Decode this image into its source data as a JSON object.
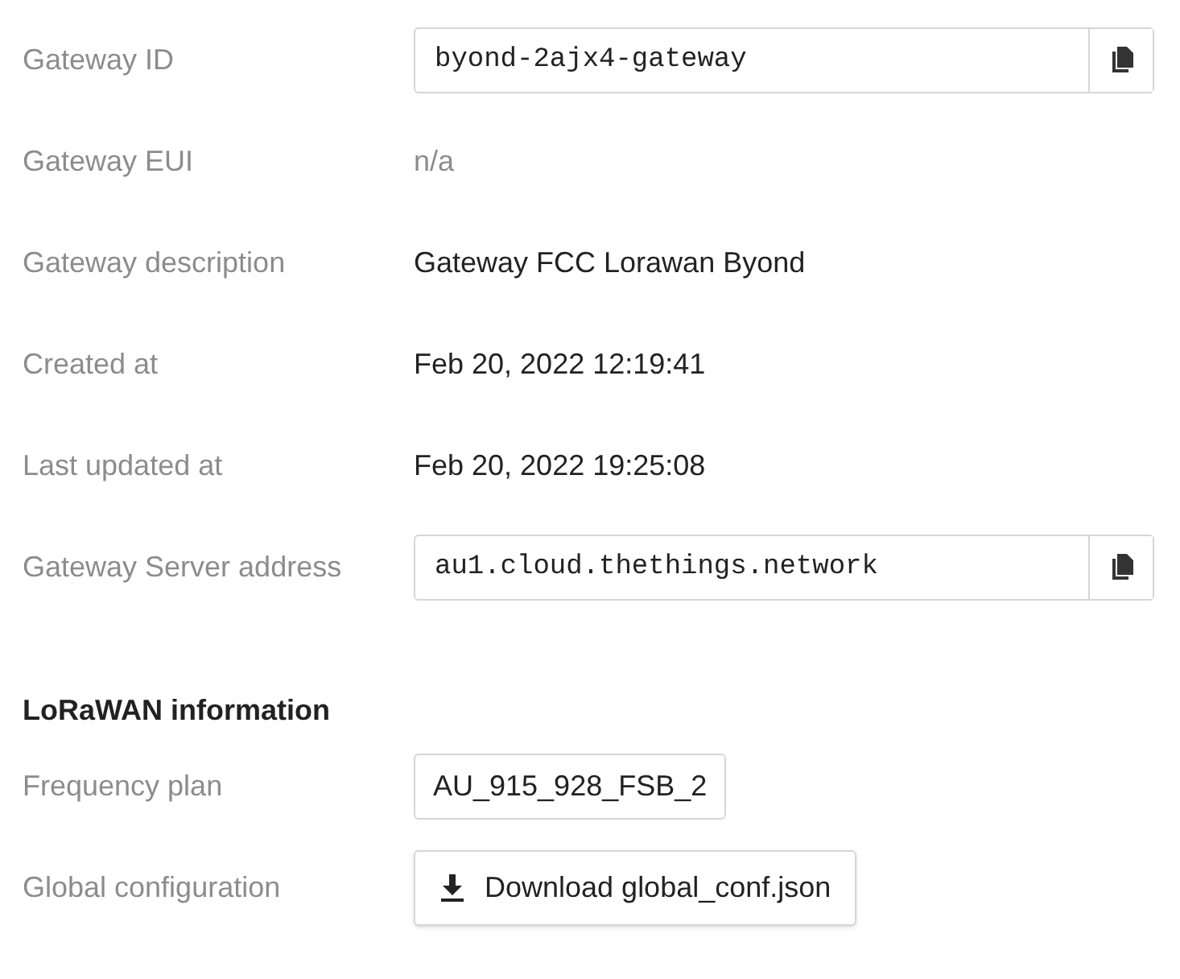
{
  "general": [
    {
      "label": "Gateway ID",
      "kind": "copy_field",
      "value": "byond-2ajx4-gateway"
    },
    {
      "label": "Gateway EUI",
      "kind": "muted",
      "value": "n/a"
    },
    {
      "label": "Gateway description",
      "kind": "text",
      "value": "Gateway FCC Lorawan Byond"
    },
    {
      "label": "Created at",
      "kind": "text",
      "value": "Feb 20, 2022 12:19:41"
    },
    {
      "label": "Last updated at",
      "kind": "text",
      "value": "Feb 20, 2022 19:25:08"
    },
    {
      "label": "Gateway Server address",
      "kind": "copy_field",
      "value": "au1.cloud.thethings.network"
    }
  ],
  "lorawan": {
    "heading": "LoRaWAN information",
    "rows": [
      {
        "label": "Frequency plan",
        "kind": "boxed",
        "value": "AU_915_928_FSB_2"
      },
      {
        "label": "Global configuration",
        "kind": "download_button",
        "value": "Download global_conf.json"
      }
    ]
  }
}
